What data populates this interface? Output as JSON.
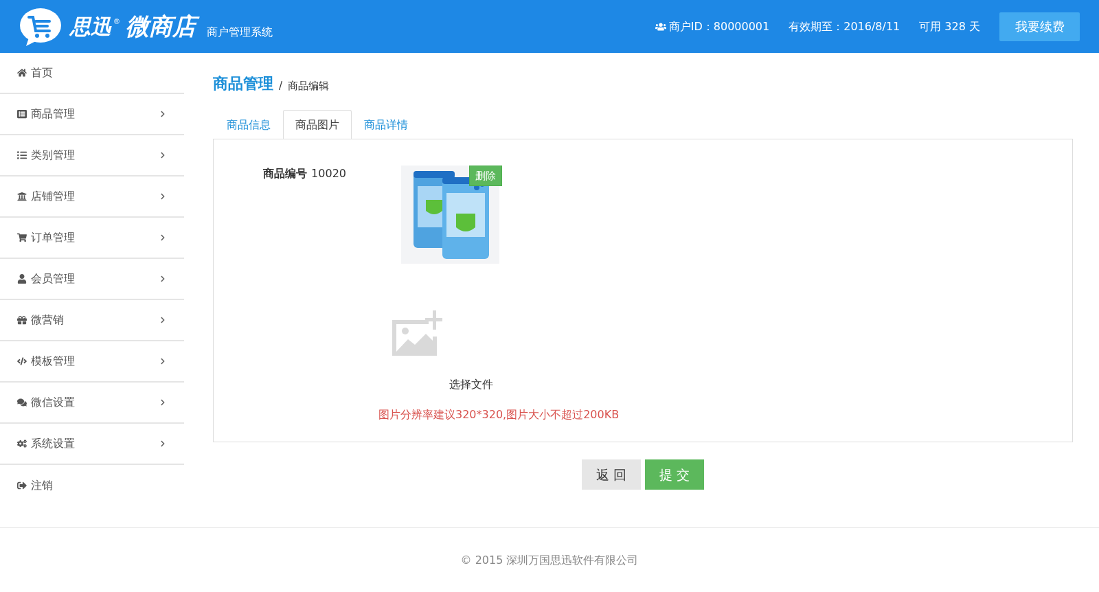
{
  "header": {
    "logo_brand": "思迅",
    "logo_mark": "®",
    "logo_product": "微商店",
    "subtitle": "商户管理系统",
    "merchant_id": "商户ID：80000001",
    "expiry": "有效期至：2016/8/11",
    "remaining": "可用 328 天",
    "renew_button": "我要续费"
  },
  "sidebar": {
    "items": [
      {
        "label": "首页",
        "kind": "link"
      },
      {
        "label": "商品管理",
        "kind": "menu"
      },
      {
        "label": "类别管理",
        "kind": "menu"
      },
      {
        "label": "店铺管理",
        "kind": "menu"
      },
      {
        "label": "订单管理",
        "kind": "menu"
      },
      {
        "label": "会员管理",
        "kind": "menu"
      },
      {
        "label": "微营销",
        "kind": "menu"
      },
      {
        "label": "模板管理",
        "kind": "menu"
      },
      {
        "label": "微信设置",
        "kind": "menu"
      },
      {
        "label": "系统设置",
        "kind": "menu"
      },
      {
        "label": "注销",
        "kind": "link"
      }
    ]
  },
  "breadcrumb": {
    "section": "商品管理",
    "separator": "/",
    "page": "商品编辑"
  },
  "tabs": [
    {
      "label": "商品信息",
      "selected": false
    },
    {
      "label": "商品图片",
      "selected": true
    },
    {
      "label": "商品详情",
      "selected": false
    }
  ],
  "form": {
    "code_label": "商品编号",
    "code_value": "10020",
    "image": {
      "kind": "picture",
      "delete_button": "删除"
    },
    "choose_file": "选择文件",
    "hint": "图片分辨率建议320*320,图片大小不超过200KB"
  },
  "buttons": [
    {
      "label": "返 回",
      "kind": "secondary"
    },
    {
      "label": "提 交",
      "kind": "primary"
    }
  ],
  "footer": "© 2015 深圳万国思迅软件有限公司"
}
